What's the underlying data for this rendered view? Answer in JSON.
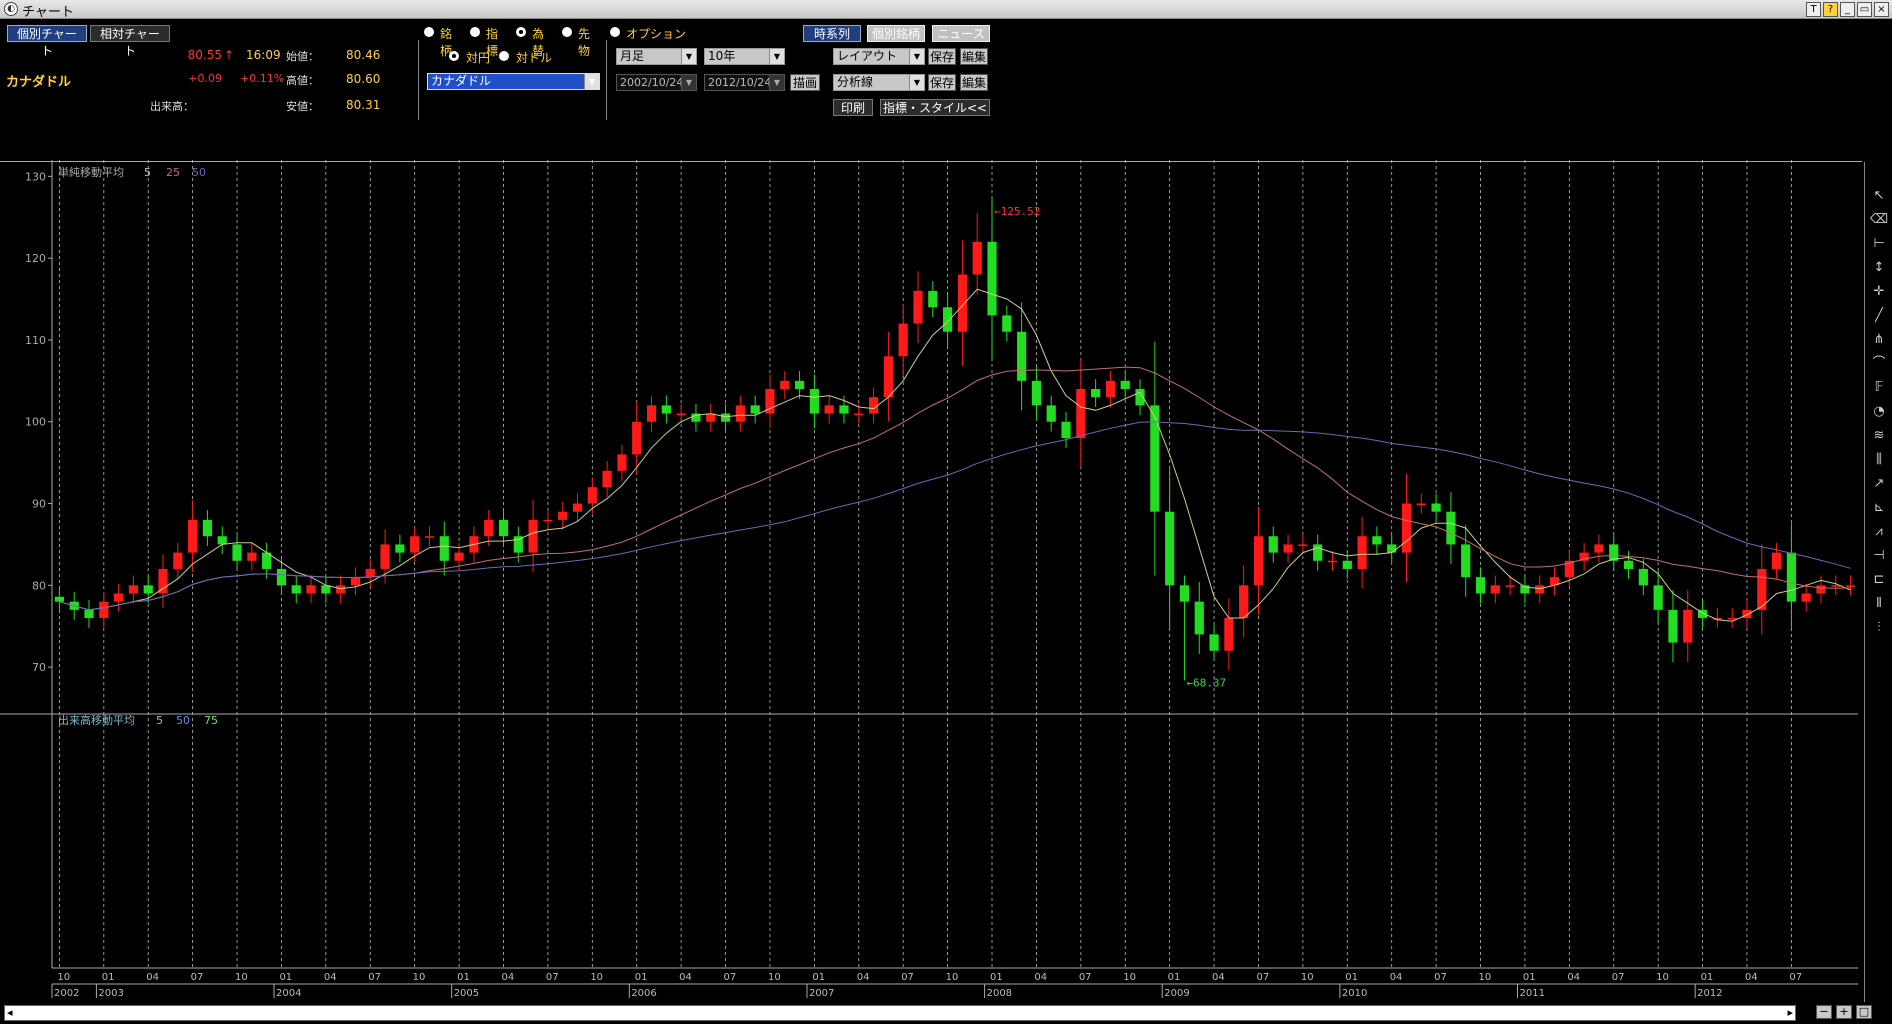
{
  "window": {
    "title": "チャート",
    "icons": [
      "T",
      "?",
      "_",
      "▭",
      "×"
    ]
  },
  "tabs": {
    "individual": "個別チャート",
    "relative": "相対チャート"
  },
  "quote": {
    "name": "カナダドル",
    "price": "80.55",
    "arrow": "↑",
    "time": "16:09",
    "change": "+0.09",
    "change_pct": "+0.11%",
    "volume_label": "出来高：",
    "open_label": "始値：",
    "open": "80.46",
    "high_label": "高値：",
    "high": "80.60",
    "low_label": "安値：",
    "low": "80.31"
  },
  "radios": {
    "row1": [
      {
        "label": "銘柄",
        "selected": false
      },
      {
        "label": "指標",
        "selected": false
      },
      {
        "label": "為替",
        "selected": true
      },
      {
        "label": "先物",
        "selected": false
      },
      {
        "label": "オプション",
        "selected": false
      }
    ],
    "row2": [
      {
        "label": "対円",
        "selected": true
      },
      {
        "label": "対ドル",
        "selected": false
      }
    ]
  },
  "currency_select": "カナダドル",
  "period": {
    "interval": "月足",
    "span": "10年",
    "from": "2002/10/24",
    "to": "2012/10/24",
    "draw": "描画"
  },
  "buttons": {
    "timeseries": "時系列",
    "individual_issue": "個別銘柄",
    "news": "ニュース",
    "layout": "レイアウト",
    "analysis": "分析線",
    "save": "保存",
    "edit": "編集",
    "print": "印刷",
    "indicator_style": "指標・スタイル<<"
  },
  "colors": {
    "up": "#ff1a1a",
    "down": "#22dd22",
    "ma5": "#c8d08a",
    "ma25": "#c07070",
    "ma50": "#6a6ab8",
    "accent_yellow": "#ffd23c",
    "grid": "#bbbbbb"
  },
  "chart_data": {
    "type": "candlestick",
    "main_title": "単純移動平均",
    "ma_periods": [
      "5",
      "25",
      "50"
    ],
    "volume_title": "出来高移動平均",
    "volume_ma_periods": [
      "5",
      "50",
      "75"
    ],
    "ylim": [
      65,
      132
    ],
    "y_ticks": [
      "130",
      "120",
      "110",
      "100",
      "90",
      "80",
      "70"
    ],
    "high_label": "←125.52",
    "low_label": "←68.37",
    "years": [
      "2002",
      "2003",
      "2004",
      "2005",
      "2006",
      "2007",
      "2008",
      "2009",
      "2010",
      "2011",
      "2012"
    ],
    "month_ticks": [
      "10",
      "01",
      "04",
      "07",
      "10",
      "01",
      "04",
      "07",
      "10",
      "01",
      "04",
      "07",
      "10",
      "01",
      "04",
      "07",
      "10",
      "01",
      "04",
      "07",
      "10",
      "01",
      "04",
      "07",
      "10",
      "01",
      "04",
      "07",
      "10",
      "01",
      "04",
      "07",
      "10",
      "01",
      "04",
      "07",
      "10",
      "01",
      "04",
      "07"
    ],
    "closes": [
      78,
      77,
      76,
      78,
      79,
      80,
      79,
      82,
      84,
      88,
      86,
      85,
      83,
      84,
      82,
      80,
      79,
      80,
      79,
      80,
      81,
      82,
      85,
      84,
      86,
      86,
      83,
      84,
      86,
      88,
      86,
      84,
      88,
      88,
      89,
      90,
      92,
      94,
      96,
      100,
      102,
      101,
      101,
      100,
      101,
      100,
      102,
      101,
      104,
      105,
      104,
      101,
      102,
      101,
      101,
      103,
      108,
      112,
      116,
      114,
      111,
      118,
      122,
      113,
      111,
      105,
      102,
      100,
      98,
      104,
      103,
      105,
      104,
      102,
      89,
      80,
      78,
      74,
      72,
      76,
      80,
      86,
      84,
      85,
      85,
      83,
      83,
      82,
      86,
      85,
      84,
      90,
      90,
      89,
      85,
      81,
      79,
      80,
      80,
      79,
      80,
      81,
      83,
      84,
      85,
      83,
      82,
      80,
      77,
      73,
      77,
      76,
      76,
      76,
      77,
      82,
      84,
      78,
      79,
      80,
      80,
      80
    ],
    "highs_note": "monthly OHLC approximated from the chart"
  },
  "toolbar_icons": [
    "cursor-icon",
    "eraser-icon",
    "hline-icon",
    "vline-icon",
    "crosshair-icon",
    "trendline-icon",
    "fan-icon",
    "arc-icon",
    "fibonacci-icon",
    "circle-icon",
    "channel-icon",
    "parallel-icon",
    "ray-icon",
    "gann-icon",
    "zigzag-icon",
    "span-icon",
    "box-icon",
    "bar-icon",
    "pitchfork-icon"
  ],
  "scrollbar": {
    "left": "◂",
    "right": "▸",
    "zoom_minus": "−",
    "zoom_plus": "+",
    "reset": "□"
  }
}
